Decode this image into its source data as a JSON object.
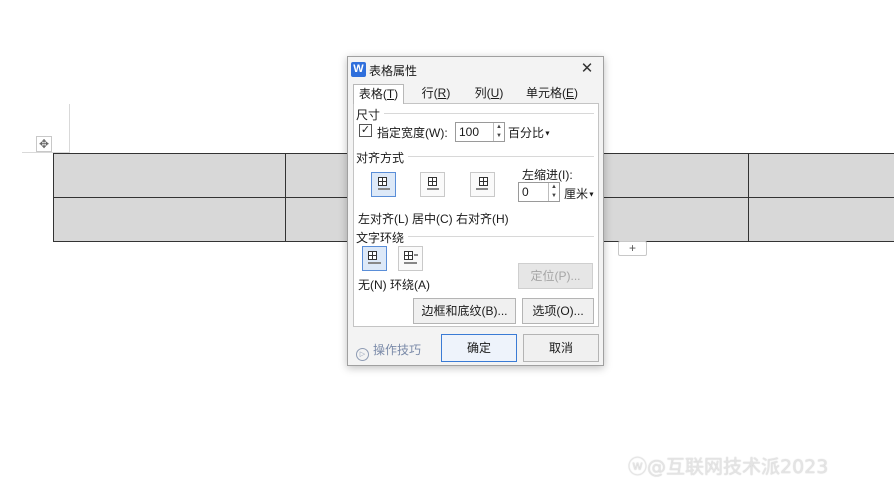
{
  "document": {
    "move_handle_glyph": "✥",
    "add_row_glyph": "+",
    "table_rows": 2,
    "table_cols": 6
  },
  "watermark": "ⓦ@互联网技术派2023",
  "dialog": {
    "app_icon": "W",
    "title": "表格属性",
    "close_glyph": "✕",
    "tabs": [
      {
        "label": "表格(",
        "key": "T",
        "suffix": ")"
      },
      {
        "label": "行(",
        "key": "R",
        "suffix": ")"
      },
      {
        "label": "列(",
        "key": "U",
        "suffix": ")"
      },
      {
        "label": "单元格(",
        "key": "E",
        "suffix": ")"
      }
    ],
    "size": {
      "section_title": "尺寸",
      "checkbox_checked": true,
      "checkbox_glyph": "✓",
      "width_label": "指定宽度(W):",
      "width_value": "100",
      "unit": "百分比"
    },
    "alignment": {
      "section_title": "对齐方式",
      "indent_label": "左缩进(I):",
      "indent_value": "0",
      "indent_unit": "厘米",
      "options_label": "左对齐(L) 居中(C) 右对齐(H)",
      "selected": "left"
    },
    "wrap": {
      "section_title": "文字环绕",
      "options_label": "无(N)  环绕(A)",
      "selected": "none",
      "position_button": "定位(P)..."
    },
    "buttons": {
      "borders": "边框和底纹(B)...",
      "options": "选项(O)...",
      "ok": "确定",
      "cancel": "取消"
    },
    "tips": {
      "icon": "▷",
      "label": "操作技巧"
    }
  }
}
